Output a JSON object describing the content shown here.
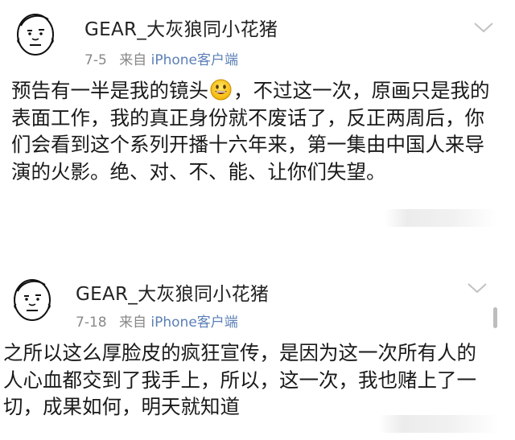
{
  "posts": [
    {
      "username": "GEAR_大灰狼同小花猪",
      "date": "7-5",
      "source_prefix": "来自",
      "source_client": "iPhone客户端",
      "content_before_emoji": "预告有一半是我的镜头",
      "content_after_emoji": "，不过这一次，原画只是我的表面工作，我的真正身份就不废话了，反正两周后，你们会看到这个系列开播十六年来，第一集由中国人来导演的火影。绝、对、不、能、让你们失望。"
    },
    {
      "username": "GEAR_大灰狼同小花猪",
      "date": "7-18",
      "source_prefix": "来自",
      "source_client": "iPhone客户端",
      "content": "之所以这么厚脸皮的疯狂宣传，是因为这一次所有人的人心血都交到了我手上，所以，这一次，我也赌上了一切，成果如何，明天就知道"
    }
  ],
  "icons": {
    "avatar": "doodle-face-avatar",
    "expand": "chevron-down-icon",
    "emoji": "grinning-face-emoji"
  },
  "colors": {
    "client_link": "#5b7fb6",
    "meta_text": "#888888"
  }
}
